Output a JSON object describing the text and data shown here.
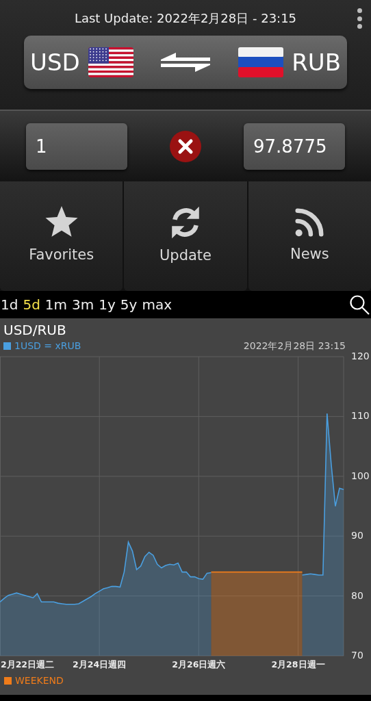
{
  "header": {
    "last_update": "Last Update: 2022年2月28日 - 23:15"
  },
  "pair": {
    "from": "USD",
    "to": "RUB"
  },
  "amounts": {
    "from_value": "1",
    "to_value": "97.8775"
  },
  "nav": [
    {
      "label": "Favorites",
      "kind": "star"
    },
    {
      "label": "Update",
      "kind": "refresh"
    },
    {
      "label": "News",
      "kind": "rss"
    }
  ],
  "ranges": [
    {
      "label": "1d",
      "selected": false
    },
    {
      "label": "5d",
      "selected": true
    },
    {
      "label": "1m",
      "selected": false
    },
    {
      "label": "3m",
      "selected": false
    },
    {
      "label": "1y",
      "selected": false
    },
    {
      "label": "5y",
      "selected": false
    },
    {
      "label": "max",
      "selected": false
    }
  ],
  "chart": {
    "title": "USD/RUB",
    "timestamp": "2022年2月28日 23:15",
    "chart_data": {
      "type": "area",
      "categories": [
        null,
        null,
        null,
        null,
        null,
        null,
        "2月22日週二",
        null,
        null,
        null,
        null,
        null,
        null,
        null,
        null,
        null,
        null,
        null,
        null,
        null,
        null,
        null,
        null,
        null,
        "2月24日週四",
        null,
        null,
        null,
        null,
        null,
        null,
        null,
        null,
        null,
        null,
        null,
        null,
        null,
        null,
        null,
        null,
        null,
        null,
        null,
        null,
        null,
        null,
        null,
        "2月26日週六",
        null,
        null,
        null,
        null,
        null,
        null,
        null,
        null,
        null,
        null,
        null,
        null,
        null,
        null,
        null,
        null,
        null,
        null,
        null,
        null,
        null,
        null,
        null,
        "2月28日週一",
        null,
        null,
        null,
        null,
        null,
        null,
        null,
        null,
        null,
        null,
        null
      ],
      "series": [
        {
          "name": "1USD = xRUB",
          "color": "#4a9fe0",
          "values": [
            79,
            79.6,
            80.1,
            80.3,
            80.5,
            80.3,
            80.1,
            79.9,
            79.7,
            80.4,
            79,
            79,
            79,
            79,
            78.8,
            78.7,
            78.6,
            78.6,
            78.6,
            78.7,
            79.1,
            79.5,
            79.9,
            80.4,
            80.8,
            81.2,
            81.4,
            81.6,
            81.6,
            81.5,
            84,
            89,
            87.5,
            84.4,
            85,
            86.6,
            87.3,
            86.8,
            85.3,
            84.7,
            85.1,
            85.3,
            85.2,
            85.5,
            84,
            84,
            83.2,
            83.2,
            82.9,
            82.8,
            83.8,
            83.9,
            null,
            null,
            null,
            null,
            null,
            null,
            null,
            null,
            null,
            null,
            null,
            null,
            null,
            null,
            null,
            null,
            null,
            null,
            null,
            null,
            null,
            83.5,
            83.6,
            83.7,
            83.6,
            83.5,
            83.5,
            110.5,
            102,
            95,
            98,
            97.8
          ]
        },
        {
          "name": "WEEKEND",
          "color": "#f07c1a",
          "values": [
            null,
            null,
            null,
            null,
            null,
            null,
            null,
            null,
            null,
            null,
            null,
            null,
            null,
            null,
            null,
            null,
            null,
            null,
            null,
            null,
            null,
            null,
            null,
            null,
            null,
            null,
            null,
            null,
            null,
            null,
            null,
            null,
            null,
            null,
            null,
            null,
            null,
            null,
            null,
            null,
            null,
            null,
            null,
            null,
            null,
            null,
            null,
            null,
            null,
            null,
            null,
            84,
            84,
            84,
            84,
            84,
            84,
            84,
            84,
            84,
            84,
            84,
            84,
            84,
            84,
            84,
            84,
            84,
            84,
            84,
            84,
            84,
            84,
            84,
            null,
            null,
            null,
            null,
            null,
            null,
            null,
            null,
            null,
            null
          ]
        }
      ],
      "ylim": [
        70,
        120
      ],
      "grid": true,
      "legend": true,
      "yticks": [
        70,
        80,
        90,
        100,
        110,
        120
      ]
    }
  }
}
